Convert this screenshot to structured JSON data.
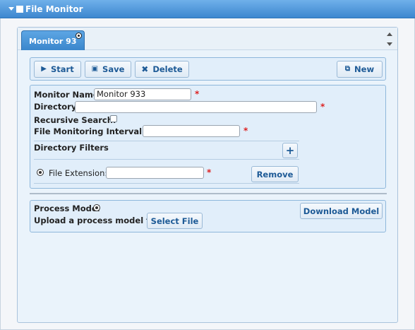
{
  "window": {
    "title": "File Monitor"
  },
  "tabs": [
    {
      "label": "Monitor 93"
    }
  ],
  "toolbar": {
    "start_label": "Start",
    "save_label": "Save",
    "delete_label": "Delete",
    "new_label": "New"
  },
  "form": {
    "monitor_name_label": "Monitor Name:",
    "monitor_name_value": "Monitor 933",
    "directory_label": "Directory:",
    "directory_value": "",
    "recursive_label": "Recursive Search:",
    "recursive_checked": false,
    "interval_label": "File Monitoring Interval (s):",
    "interval_value": "",
    "required_marker": "*"
  },
  "filters": {
    "heading": "Directory Filters",
    "add_label": "+",
    "extension_label": "File Extension:",
    "extension_value": "",
    "remove_label": "Remove"
  },
  "process_model": {
    "label": "Process Model",
    "upload_label": "Upload a process model file:",
    "select_file_label": "Select File",
    "download_label": "Download Model"
  }
}
